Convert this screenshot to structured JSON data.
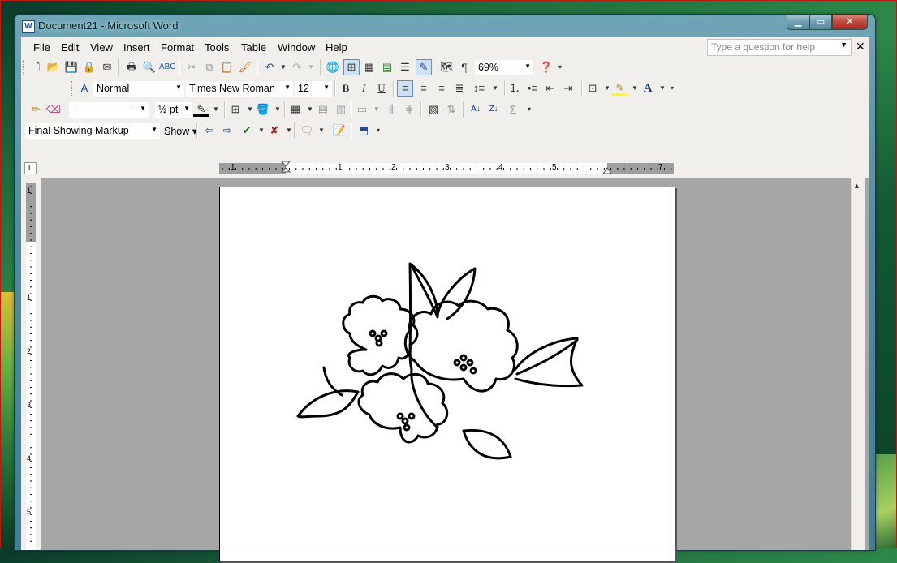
{
  "window": {
    "title": "Document21 - Microsoft Word",
    "app_icon_letter": "W"
  },
  "caption_buttons": {
    "minimize": "▁",
    "maximize": "▭",
    "close": "✕"
  },
  "menubar": {
    "items": [
      "File",
      "Edit",
      "View",
      "Insert",
      "Format",
      "Tools",
      "Table",
      "Window",
      "Help"
    ],
    "help_placeholder": "Type a question for help",
    "doc_close": "✕"
  },
  "standard_toolbar": {
    "zoom": "69%"
  },
  "formatting_toolbar": {
    "style": "Normal",
    "font": "Times New Roman",
    "size": "12"
  },
  "drawing_toolbar": {
    "line_weight": "½ pt"
  },
  "reviewing_toolbar": {
    "display_mode": "Final Showing Markup",
    "show_label": "Show"
  },
  "ruler": {
    "h_numbers": [
      "1",
      "1",
      "2",
      "3",
      "4",
      "5",
      "7"
    ],
    "v_numbers": [
      "1",
      "1",
      "2",
      "3",
      "4",
      "5"
    ]
  },
  "document": {
    "image": "flower-line-drawing"
  }
}
